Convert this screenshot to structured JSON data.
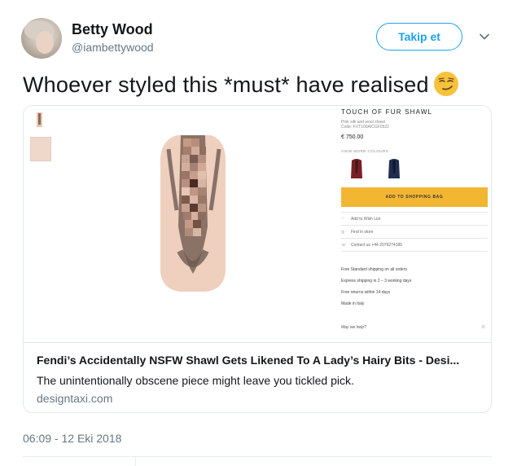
{
  "user": {
    "name": "Betty Wood",
    "handle": "@iambettywood"
  },
  "follow_button": {
    "label": "Takip et"
  },
  "tweet": {
    "text": "Whoever styled this *must* have realised",
    "emoji": "smirking-face"
  },
  "card": {
    "title": "Fendi’s Accidentally NSFW Shawl Gets Likened To A Lady’s Hairy Bits - Desi...",
    "description": "The unintentionally obscene piece might leave you tickled pick.",
    "domain": "designtaxi.com",
    "image": {
      "product_title": "TOUCH OF FUR SHAWL",
      "product_subtitle": "Pink silk and wool shawl",
      "product_code": "Code: FXT100AICGF0522",
      "price": "€ 750.00",
      "more_colours_label": "VIEW MORE COLOURS",
      "add_to_bag_label": "ADD TO SHOPPING BAG",
      "links": [
        "Add to Wish List",
        "Find in store",
        "Contact us +44 2079274185"
      ],
      "shipping": [
        "Free Standard shipping on all orders",
        "Express shipping in 2 – 3 working days",
        "Free returns within 14 days",
        "Made in Italy"
      ],
      "help_label": "May we help?",
      "colors": {
        "swatch_red": "#7a1f26",
        "swatch_navy": "#1f2d4f",
        "button": "#f2b632"
      }
    }
  },
  "timestamp": "06:09 - 12 Eki 2018",
  "colors": {
    "accent": "#1da1f2",
    "secondary_text": "#657786",
    "border": "#e1e8ed"
  }
}
